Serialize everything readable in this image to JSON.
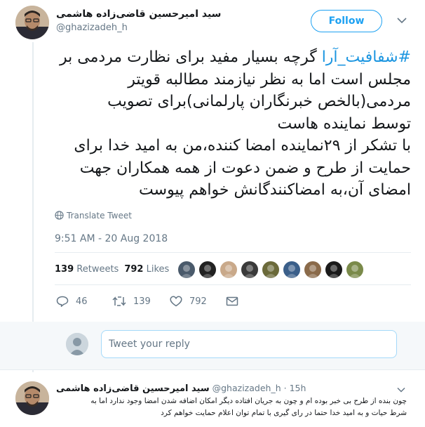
{
  "tweet": {
    "author_name": "سید امیرحسین قاضی‌زاده هاشمی",
    "author_handle": "@ghazizadeh_h",
    "follow_label": "Follow",
    "text_lines": [
      {
        "hashtag": "#شفافیت_آرا",
        "text": " گرچه بسیار مفید برای نظارت مردمی بر"
      },
      {
        "hashtag": "",
        "text": "مجلس است اما به نظر نیازمند مطالبه قویتر"
      },
      {
        "hashtag": "",
        "text": "مردمی(بالخص خبرنگاران پارلمانی)برای تصویب"
      },
      {
        "hashtag": "",
        "text": "توسط نماینده هاست"
      },
      {
        "hashtag": "",
        "text": "با تشکر از ۲۹نماینده امضا کننده،من به امید خدا برای"
      },
      {
        "hashtag": "",
        "text": "حمایت از طرح و ضمن دعوت از همه همکاران جهت"
      },
      {
        "hashtag": "",
        "text": "امضای آن،به امضاکنندگانش خواهم پیوست"
      }
    ],
    "translate_label": "Translate Tweet",
    "timestamp": "9:51 AM - 20 Aug 2018",
    "retweets_count": "139",
    "retweets_label": "Retweets",
    "likes_count": "792",
    "likes_label": "Likes",
    "actions": {
      "reply_count": "46",
      "retweet_count": "139",
      "like_count": "792"
    }
  },
  "likers": [
    {
      "icon": "avatar-1",
      "bg": "#4a5a6b"
    },
    {
      "icon": "avatar-2",
      "bg": "#222222"
    },
    {
      "icon": "avatar-3",
      "bg": "#c9a98a"
    },
    {
      "icon": "avatar-4",
      "bg": "#3a3a3a"
    },
    {
      "icon": "avatar-5",
      "bg": "#6b6a3a"
    },
    {
      "icon": "avatar-6",
      "bg": "#3b5f8a"
    },
    {
      "icon": "avatar-7",
      "bg": "#8a6a4a"
    },
    {
      "icon": "avatar-8",
      "bg": "#1a1a1a"
    },
    {
      "icon": "avatar-9",
      "bg": "#7a8a4a"
    }
  ],
  "reply_box": {
    "placeholder": "Tweet your reply"
  },
  "reply_tweet": {
    "author_name": "سید امیرحسین قاضی‌زاده هاشمی",
    "author_handle": "@ghazizadeh_h",
    "time": "· 15h",
    "text_lines": [
      "چون بنده از طرح بی خبر بوده ام و چون به جریان افتاده دیگر امکان اضافه شدن امضا وجود ندارد اما به",
      "شرط حیات و به امید خدا حتما در رای گیری با تمام توان اعلام حمایت خواهم کرد"
    ]
  },
  "colors": {
    "accent": "#1da1f2",
    "hashtag": "#1b95e0",
    "muted": "#657786",
    "text": "#14171a",
    "divider": "#e6ecf0"
  }
}
